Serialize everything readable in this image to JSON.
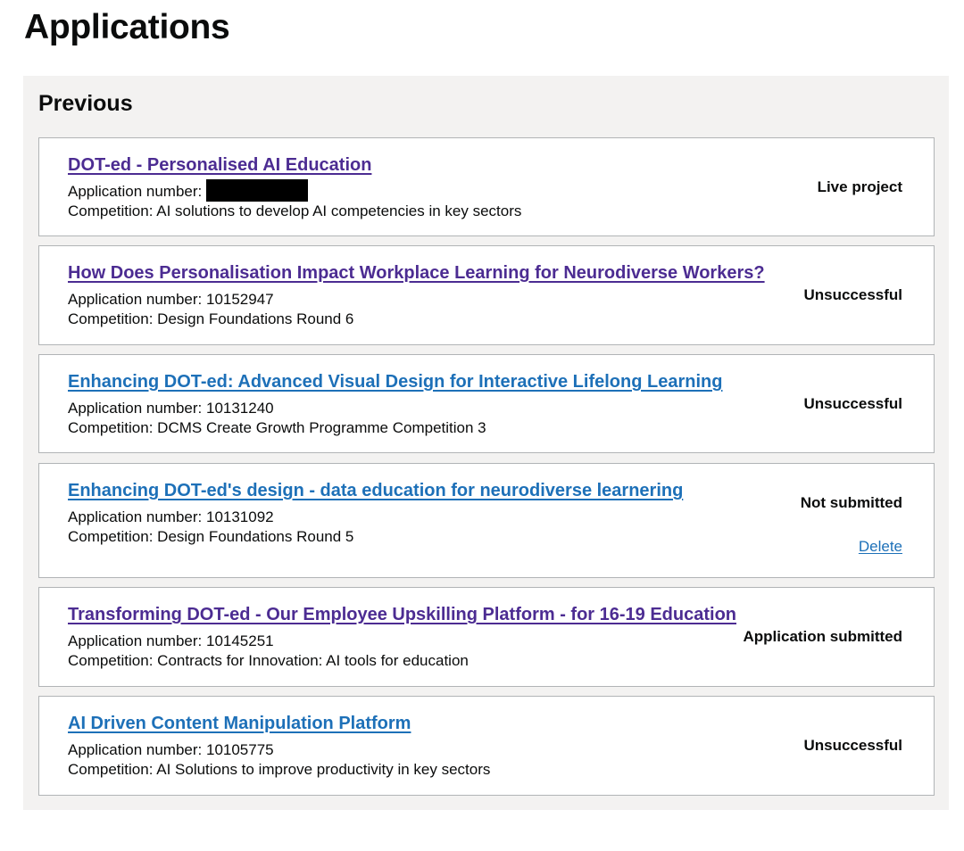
{
  "page": {
    "title": "Applications"
  },
  "section": {
    "title": "Previous"
  },
  "labels": {
    "application_number": "Application number: ",
    "competition": "Competition: "
  },
  "colors": {
    "visited_link": "#4c2c92",
    "link": "#1d70b8",
    "panel_background": "#f3f2f1",
    "card_border": "#b1b4b6"
  },
  "applications": [
    {
      "title": "DOT-ed - Personalised AI Education",
      "application_number": "",
      "application_number_redacted": true,
      "competition": "AI solutions to develop AI competencies in key sectors",
      "status": "Live project",
      "link_state": "visited"
    },
    {
      "title": "How Does Personalisation Impact Workplace Learning for Neurodiverse Workers?",
      "application_number": "10152947",
      "competition": "Design Foundations Round 6",
      "status": "Unsuccessful",
      "link_state": "visited"
    },
    {
      "title": "Enhancing DOT-ed: Advanced Visual Design for Interactive Lifelong Learning",
      "application_number": "10131240",
      "competition": "DCMS Create Growth Programme Competition 3",
      "status": "Unsuccessful",
      "link_state": "unvisited"
    },
    {
      "title": "Enhancing DOT-ed's design - data education for neurodiverse learnering",
      "application_number": "10131092",
      "competition": "Design Foundations Round 5",
      "status": "Not submitted",
      "action": "Delete",
      "link_state": "unvisited"
    },
    {
      "title": "Transforming DOT-ed - Our Employee Upskilling Platform - for 16-19 Education",
      "application_number": "10145251",
      "competition": "Contracts for Innovation: AI tools for education",
      "status": "Application submitted",
      "link_state": "visited"
    },
    {
      "title": "AI Driven Content Manipulation Platform",
      "application_number": "10105775",
      "competition": "AI Solutions to improve productivity in key sectors",
      "status": "Unsuccessful",
      "link_state": "unvisited"
    }
  ]
}
